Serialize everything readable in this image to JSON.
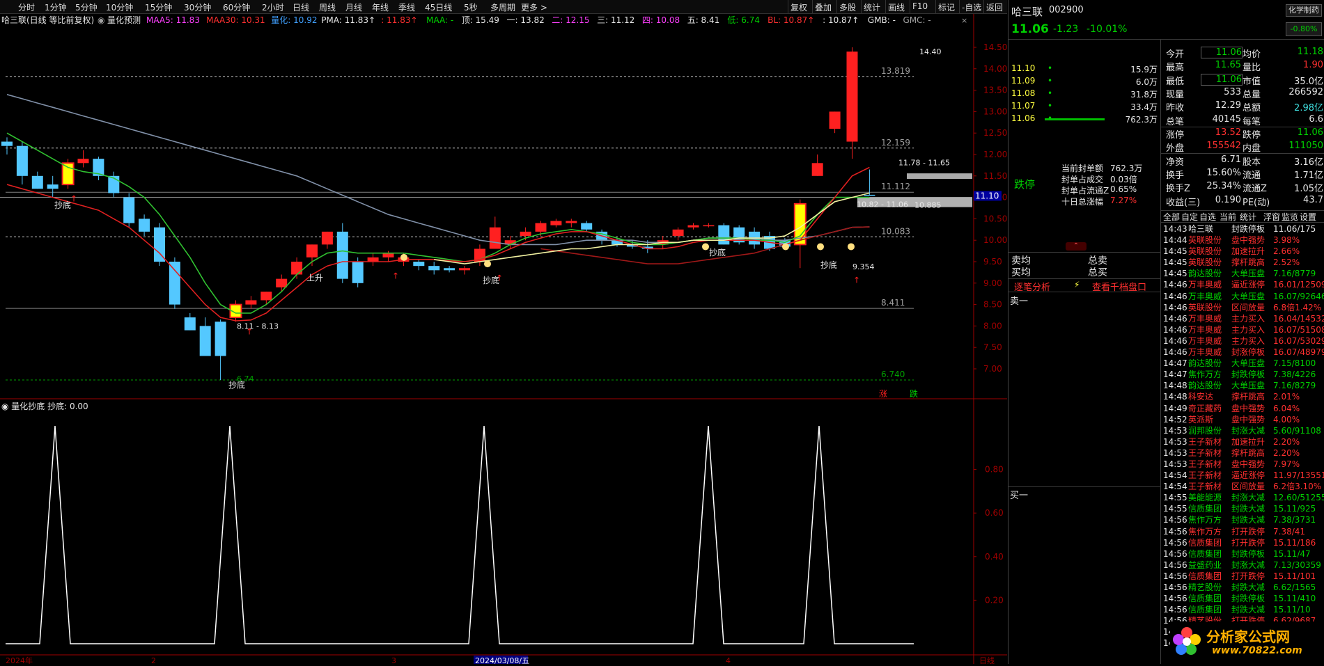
{
  "toolbar": {
    "periods": [
      "分时",
      "1分钟",
      "5分钟",
      "10分钟",
      "15分钟",
      "30分钟",
      "60分钟",
      "2小时",
      "日线",
      "周线",
      "月线",
      "年线",
      "季线",
      "45日线",
      "5秒",
      "多周期",
      "更多 >"
    ],
    "right_buttons": [
      "复权",
      "叠加",
      "多股",
      "统计",
      "画线",
      "F10",
      "标记",
      "-自选",
      "返回"
    ]
  },
  "main_chart": {
    "title": "哈三联(日线 等比前复权)",
    "indicator_name": "量化预测",
    "legend": [
      {
        "text": "MAA5: 11.83",
        "color": "#ff40ff"
      },
      {
        "text": "MAA30: 10.31",
        "color": "#ff3030"
      },
      {
        "text": "量化: 10.92",
        "color": "#40a0ff"
      },
      {
        "text": "PMA: 11.83↑",
        "color": "#e6e6e6"
      },
      {
        "text": ": 11.83↑",
        "color": "#ff3030"
      },
      {
        "text": "MAA: -",
        "color": "#00d000"
      },
      {
        "text": "顶: 15.49",
        "color": "#e6e6e6"
      },
      {
        "text": "一: 13.82",
        "color": "#e6e6e6"
      },
      {
        "text": "二: 12.15",
        "color": "#ff40ff"
      },
      {
        "text": "三: 11.12",
        "color": "#e6e6e6"
      },
      {
        "text": "四: 10.08",
        "color": "#ff40ff"
      },
      {
        "text": "五: 8.41",
        "color": "#e6e6e6"
      },
      {
        "text": "低: 6.74",
        "color": "#00d000"
      },
      {
        "text": "BL: 10.87↑",
        "color": "#ff3030"
      },
      {
        "text": ": 10.87↑",
        "color": "#e6e6e6"
      },
      {
        "text": "GMB: -",
        "color": "#e6e6e6"
      },
      {
        "text": "GMC: -",
        "color": "#a0a0a0"
      }
    ],
    "y_ticks": [
      "14.50",
      "14.00",
      "13.50",
      "13.00",
      "12.50",
      "12.00",
      "11.50",
      "11.00",
      "10.50",
      "10.00",
      "9.50",
      "9.00",
      "8.50",
      "8.00",
      "7.50",
      "7.00"
    ],
    "current_price_tag": "11.10",
    "level_labels": [
      "13.819",
      "12.159",
      "11.112",
      "10.083",
      "8.411",
      "6.740"
    ],
    "annotations": [
      "14.40",
      "11.78 - 11.65",
      "10.82 - 11.06",
      "10.885",
      "8.11 - 8.13",
      "6.74",
      "9.354"
    ],
    "signal_text": "抄底",
    "rise_text": "上升",
    "corner_labels": {
      "up": "涨",
      "down": "跌"
    }
  },
  "sub_chart": {
    "title": "量化抄底 抄底: 0.00",
    "y_ticks": [
      "0.80",
      "0.60",
      "0.40",
      "0.20"
    ]
  },
  "x_axis": {
    "labels": [
      "2024年",
      "2",
      "3",
      "2024/03/08/五",
      "4"
    ],
    "period": "日线"
  },
  "quote": {
    "name": "哈三联",
    "code": "002900",
    "tag": "化学制药",
    "price": "11.06",
    "change": "-1.23",
    "change_pct": "-10.01%",
    "sector_pct": "-0.80%",
    "order_book": [
      {
        "price": "11.10",
        "vol": "15.9万",
        "bar": 0
      },
      {
        "price": "11.09",
        "vol": "6.0万",
        "bar": 0
      },
      {
        "price": "11.08",
        "vol": "31.8万",
        "bar": 0
      },
      {
        "price": "11.07",
        "vol": "33.4万",
        "bar": 0
      },
      {
        "price": "11.06",
        "vol": "762.3万",
        "bar": 1
      }
    ],
    "stats": [
      {
        "l": "今开",
        "v": "11.06",
        "l2": "均价",
        "v2": "11.18"
      },
      {
        "l": "最高",
        "v": "11.65",
        "l2": "量比",
        "v2": "1.90"
      },
      {
        "l": "最低",
        "v": "11.06",
        "l2": "市值",
        "v2": "35.0亿"
      },
      {
        "l": "现量",
        "v": "533",
        "l2": "总量",
        "v2": "266592"
      },
      {
        "l": "昨收",
        "v": "12.29",
        "l2": "总额",
        "v2": "2.98亿"
      },
      {
        "l": "总笔",
        "v": "40145",
        "l2": "每笔",
        "v2": "6.6"
      },
      {
        "l": "涨停",
        "v": "13.52",
        "l2": "跌停",
        "v2": "11.06"
      },
      {
        "l": "外盘",
        "v": "155542",
        "l2": "内盘",
        "v2": "111050"
      },
      {
        "l": "净资",
        "v": "6.71",
        "l2": "股本",
        "v2": "3.16亿"
      },
      {
        "l": "换手",
        "v": "15.60%",
        "l2": "流通",
        "v2": "1.71亿"
      },
      {
        "l": "换手Z",
        "v": "25.34%",
        "l2": "流通Z",
        "v2": "1.05亿"
      },
      {
        "l": "收益(三)",
        "v": "0.190",
        "l2": "PE(动)",
        "v2": "43.7"
      }
    ],
    "limit": {
      "status": "跌停",
      "lines": [
        {
          "k": "当前封单额",
          "v": "762.3万"
        },
        {
          "k": "封单占成交",
          "v": "0.03倍"
        },
        {
          "k": "封单占流通Z",
          "v": "0.65%"
        },
        {
          "k": "十日总涨幅",
          "v": "7.27%"
        }
      ]
    },
    "sell_avg": "卖均",
    "buy_avg": "买均",
    "total_sell": "总卖",
    "total_buy": "总买",
    "tick_analysis": "逐笔分析",
    "thousand_levels": "查看千档盘口",
    "sell1": "卖一",
    "buy1": "买一"
  },
  "news_tabs": [
    "全部",
    "自定",
    "自选",
    "当前",
    "统计",
    "浮窗",
    "监览",
    "设置"
  ],
  "ticks": [
    {
      "t": "14:43",
      "n": "哈三联",
      "e": "封跌停板",
      "v": "11.06/175",
      "c": "w"
    },
    {
      "t": "14:44",
      "n": "英联股份",
      "e": "盘中强势",
      "v": "3.98%",
      "c": "r"
    },
    {
      "t": "14:45",
      "n": "英联股份",
      "e": "加速拉升",
      "v": "2.66%",
      "c": "r"
    },
    {
      "t": "14:45",
      "n": "英联股份",
      "e": "撑杆跳高",
      "v": "2.52%",
      "c": "r"
    },
    {
      "t": "14:45",
      "n": "韵达股份",
      "e": "大单压盘",
      "v": "7.16/8779",
      "c": "g"
    },
    {
      "t": "14:46",
      "n": "万丰奥威",
      "e": "逼近涨停",
      "v": "16.01/12509",
      "c": "r"
    },
    {
      "t": "14:46",
      "n": "万丰奥威",
      "e": "大单压盘",
      "v": "16.07/92646",
      "c": "g"
    },
    {
      "t": "14:46",
      "n": "英联股份",
      "e": "区间放量",
      "v": "6.8倍1.42%",
      "c": "r"
    },
    {
      "t": "14:46",
      "n": "万丰奥威",
      "e": "主力买入",
      "v": "16.04/14532",
      "c": "r"
    },
    {
      "t": "14:46",
      "n": "万丰奥威",
      "e": "主力买入",
      "v": "16.07/51508",
      "c": "r"
    },
    {
      "t": "14:46",
      "n": "万丰奥威",
      "e": "主力买入",
      "v": "16.07/53029",
      "c": "r"
    },
    {
      "t": "14:46",
      "n": "万丰奥威",
      "e": "封涨停板",
      "v": "16.07/489794",
      "c": "r"
    },
    {
      "t": "14:47",
      "n": "韵达股份",
      "e": "大单压盘",
      "v": "7.15/8100",
      "c": "g"
    },
    {
      "t": "14:47",
      "n": "焦作万方",
      "e": "封跌停板",
      "v": "7.38/4226",
      "c": "g"
    },
    {
      "t": "14:48",
      "n": "韵达股份",
      "e": "大单压盘",
      "v": "7.16/8279",
      "c": "g"
    },
    {
      "t": "14:48",
      "n": "科安达",
      "e": "撑杆跳高",
      "v": "2.01%",
      "c": "r"
    },
    {
      "t": "14:49",
      "n": "奇正藏药",
      "e": "盘中强势",
      "v": "6.04%",
      "c": "r"
    },
    {
      "t": "14:52",
      "n": "英派斯",
      "e": "盘中强势",
      "v": "4.00%",
      "c": "r"
    },
    {
      "t": "14:53",
      "n": "润邦股份",
      "e": "封涨大减",
      "v": "5.60/91108",
      "c": "g"
    },
    {
      "t": "14:53",
      "n": "王子新材",
      "e": "加速拉升",
      "v": "2.20%",
      "c": "r"
    },
    {
      "t": "14:53",
      "n": "王子新材",
      "e": "撑杆跳高",
      "v": "2.20%",
      "c": "r"
    },
    {
      "t": "14:53",
      "n": "王子新材",
      "e": "盘中强势",
      "v": "7.97%",
      "c": "r"
    },
    {
      "t": "14:54",
      "n": "王子新材",
      "e": "逼近涨停",
      "v": "11.97/13551",
      "c": "r"
    },
    {
      "t": "14:54",
      "n": "王子新材",
      "e": "区间放量",
      "v": "6.2倍3.10%",
      "c": "r"
    },
    {
      "t": "14:55",
      "n": "美能能源",
      "e": "封涨大减",
      "v": "12.60/51255",
      "c": "g"
    },
    {
      "t": "14:55",
      "n": "信质集团",
      "e": "封跌大减",
      "v": "15.11/925",
      "c": "g"
    },
    {
      "t": "14:56",
      "n": "焦作万方",
      "e": "封跌大减",
      "v": "7.38/3731",
      "c": "g"
    },
    {
      "t": "14:56",
      "n": "焦作万方",
      "e": "打开跌停",
      "v": "7.38/41",
      "c": "r"
    },
    {
      "t": "14:56",
      "n": "信质集团",
      "e": "打开跌停",
      "v": "15.11/186",
      "c": "r"
    },
    {
      "t": "14:56",
      "n": "信质集团",
      "e": "封跌停板",
      "v": "15.11/47",
      "c": "g"
    },
    {
      "t": "14:56",
      "n": "益盛药业",
      "e": "封涨大减",
      "v": "7.13/30359",
      "c": "g"
    },
    {
      "t": "14:56",
      "n": "信质集团",
      "e": "打开跌停",
      "v": "15.11/101",
      "c": "r"
    },
    {
      "t": "14:56",
      "n": "精艺股份",
      "e": "封跌大减",
      "v": "6.62/1565",
      "c": "g"
    },
    {
      "t": "14:56",
      "n": "信质集团",
      "e": "封跌停板",
      "v": "15.11/410",
      "c": "g"
    },
    {
      "t": "14:56",
      "n": "信质集团",
      "e": "封跌大减",
      "v": "15.11/10",
      "c": "g"
    },
    {
      "t": "14:56",
      "n": "精艺股份",
      "e": "打开跌停",
      "v": "6.62/9687",
      "c": "r"
    },
    {
      "t": "14:5",
      "n": "",
      "e": "",
      "v": "",
      "c": "w"
    },
    {
      "t": "14:5",
      "n": "",
      "e": "",
      "v": "",
      "c": "w"
    }
  ],
  "watermark": {
    "text": "分析家公式网",
    "url": "www.70822.com"
  },
  "chart_data": {
    "type": "candlestick",
    "ylim": [
      6.6,
      14.7
    ],
    "candles": [
      {
        "o": 12.2,
        "h": 12.4,
        "l": 12.0,
        "c": 12.3,
        "u": 0
      },
      {
        "o": 12.2,
        "h": 12.3,
        "l": 11.3,
        "c": 11.5,
        "u": 0
      },
      {
        "o": 11.5,
        "h": 11.6,
        "l": 11.2,
        "c": 11.2,
        "u": 0
      },
      {
        "o": 11.3,
        "h": 11.5,
        "l": 11.0,
        "c": 11.2,
        "u": 0
      },
      {
        "o": 11.3,
        "h": 11.9,
        "l": 11.2,
        "c": 11.8,
        "u": 1
      },
      {
        "o": 11.8,
        "h": 12.1,
        "l": 11.7,
        "c": 11.9,
        "u": 1
      },
      {
        "o": 11.9,
        "h": 11.95,
        "l": 11.4,
        "c": 11.5,
        "u": 0
      },
      {
        "o": 11.5,
        "h": 11.6,
        "l": 11.0,
        "c": 11.1,
        "u": 0
      },
      {
        "o": 11.0,
        "h": 11.1,
        "l": 10.3,
        "c": 10.4,
        "u": 0
      },
      {
        "o": 10.5,
        "h": 10.6,
        "l": 10.1,
        "c": 10.2,
        "u": 0
      },
      {
        "o": 10.3,
        "h": 10.4,
        "l": 9.4,
        "c": 9.5,
        "u": 0
      },
      {
        "o": 9.5,
        "h": 9.6,
        "l": 8.4,
        "c": 8.5,
        "u": 0
      },
      {
        "o": 8.2,
        "h": 8.3,
        "l": 7.9,
        "c": 7.9,
        "u": 0
      },
      {
        "o": 8.0,
        "h": 8.2,
        "l": 7.3,
        "c": 7.3,
        "u": 0
      },
      {
        "o": 8.1,
        "h": 8.15,
        "l": 6.74,
        "c": 7.3,
        "u": 0
      },
      {
        "o": 8.2,
        "h": 8.6,
        "l": 8.1,
        "c": 8.5,
        "u": 1
      },
      {
        "o": 8.5,
        "h": 8.7,
        "l": 8.4,
        "c": 8.6,
        "u": 1
      },
      {
        "o": 8.6,
        "h": 8.8,
        "l": 8.5,
        "c": 8.8,
        "u": 1
      },
      {
        "o": 8.9,
        "h": 9.2,
        "l": 8.8,
        "c": 9.1,
        "u": 1
      },
      {
        "o": 9.2,
        "h": 9.6,
        "l": 9.1,
        "c": 9.5,
        "u": 1
      },
      {
        "o": 9.6,
        "h": 9.9,
        "l": 9.4,
        "c": 9.9,
        "u": 1
      },
      {
        "o": 9.9,
        "h": 10.2,
        "l": 9.8,
        "c": 10.2,
        "u": 1
      },
      {
        "o": 10.2,
        "h": 10.4,
        "l": 9.0,
        "c": 9.1,
        "u": 0
      },
      {
        "o": 9.5,
        "h": 9.6,
        "l": 8.9,
        "c": 9.0,
        "u": 0
      },
      {
        "o": 9.5,
        "h": 9.7,
        "l": 9.4,
        "c": 9.6,
        "u": 1
      },
      {
        "o": 9.6,
        "h": 9.75,
        "l": 9.5,
        "c": 9.7,
        "u": 1
      },
      {
        "o": 9.6,
        "h": 9.7,
        "l": 9.4,
        "c": 9.5,
        "u": 1
      },
      {
        "o": 9.5,
        "h": 9.55,
        "l": 9.3,
        "c": 9.4,
        "u": 0
      },
      {
        "o": 9.4,
        "h": 9.5,
        "l": 9.2,
        "c": 9.3,
        "u": 0
      },
      {
        "o": 9.35,
        "h": 9.4,
        "l": 9.25,
        "c": 9.3,
        "u": 0
      },
      {
        "o": 9.3,
        "h": 9.4,
        "l": 9.2,
        "c": 9.35,
        "u": 1
      },
      {
        "o": 9.5,
        "h": 9.9,
        "l": 9.4,
        "c": 9.8,
        "u": 1
      },
      {
        "o": 9.8,
        "h": 10.55,
        "l": 9.8,
        "c": 10.3,
        "u": 1
      },
      {
        "o": 9.9,
        "h": 10.1,
        "l": 9.8,
        "c": 10.0,
        "u": 1
      },
      {
        "o": 10.1,
        "h": 10.3,
        "l": 10.0,
        "c": 10.2,
        "u": 1
      },
      {
        "o": 10.2,
        "h": 10.45,
        "l": 10.1,
        "c": 10.4,
        "u": 1
      },
      {
        "o": 10.35,
        "h": 10.5,
        "l": 10.3,
        "c": 10.45,
        "u": 1
      },
      {
        "o": 10.4,
        "h": 10.5,
        "l": 10.3,
        "c": 10.45,
        "u": 1
      },
      {
        "o": 10.4,
        "h": 10.45,
        "l": 10.2,
        "c": 10.25,
        "u": 0
      },
      {
        "o": 10.2,
        "h": 10.25,
        "l": 9.9,
        "c": 10.0,
        "u": 0
      },
      {
        "o": 10.0,
        "h": 10.05,
        "l": 9.85,
        "c": 9.9,
        "u": 0
      },
      {
        "o": 9.9,
        "h": 10.0,
        "l": 9.8,
        "c": 9.85,
        "u": 0
      },
      {
        "o": 9.85,
        "h": 10.0,
        "l": 9.7,
        "c": 9.8,
        "u": 0
      },
      {
        "o": 9.9,
        "h": 10.1,
        "l": 9.8,
        "c": 10.0,
        "u": 1
      },
      {
        "o": 10.1,
        "h": 10.3,
        "l": 10.0,
        "c": 10.25,
        "u": 1
      },
      {
        "o": 10.3,
        "h": 10.4,
        "l": 10.25,
        "c": 10.35,
        "u": 1
      },
      {
        "o": 10.35,
        "h": 10.4,
        "l": 10.3,
        "c": 10.35,
        "u": 1
      },
      {
        "o": 10.35,
        "h": 10.4,
        "l": 9.9,
        "c": 9.9,
        "u": 0
      },
      {
        "o": 10.3,
        "h": 10.35,
        "l": 9.9,
        "c": 9.95,
        "u": 0
      },
      {
        "o": 10.2,
        "h": 10.3,
        "l": 9.8,
        "c": 9.9,
        "u": 0
      },
      {
        "o": 10.1,
        "h": 10.2,
        "l": 9.75,
        "c": 9.8,
        "u": 0
      },
      {
        "o": 10.0,
        "h": 10.05,
        "l": 9.8,
        "c": 9.85,
        "u": 0
      },
      {
        "o": 9.9,
        "h": 10.95,
        "l": 9.35,
        "c": 10.85,
        "u": 1
      },
      {
        "o": 11.8,
        "h": 12.0,
        "l": 11.5,
        "c": 11.5,
        "u": 1
      },
      {
        "o": 12.6,
        "h": 13.0,
        "l": 12.5,
        "c": 13.0,
        "u": 1
      },
      {
        "o": 14.4,
        "h": 14.5,
        "l": 11.9,
        "c": 12.3,
        "u": 1
      },
      {
        "o": 11.06,
        "h": 11.65,
        "l": 11.06,
        "c": 11.06,
        "u": 0
      }
    ],
    "ma_red": [
      11.3,
      11.2,
      11.1,
      11.0,
      10.9,
      10.8,
      10.7,
      10.5,
      10.3,
      10.0,
      9.7,
      9.3,
      8.9,
      8.5,
      8.2,
      8.12,
      8.14,
      8.3,
      8.6,
      8.9,
      9.2,
      9.4,
      9.5,
      9.5,
      9.5,
      9.5,
      9.55,
      9.55,
      9.55,
      9.52,
      9.5,
      9.55,
      9.65,
      9.8,
      9.95,
      10.05,
      10.15,
      10.2,
      10.2,
      10.1,
      10.0,
      9.9,
      9.8,
      9.8,
      9.85,
      9.95,
      10.0,
      10.0,
      10.0,
      10.0,
      9.95,
      9.9,
      10.0,
      10.5,
      11.0,
      11.5,
      11.7
    ],
    "ma_green": [
      12.5,
      12.3,
      12.1,
      11.9,
      11.7,
      11.6,
      11.55,
      11.45,
      11.25,
      11.0,
      10.6,
      10.1,
      9.6,
      9.0,
      8.5,
      8.3,
      8.3,
      8.5,
      8.8,
      9.2,
      9.5,
      9.7,
      9.75,
      9.7,
      9.7,
      9.7,
      9.7,
      9.65,
      9.6,
      9.55,
      9.5,
      9.55,
      9.7,
      9.9,
      10.05,
      10.15,
      10.2,
      10.25,
      10.2,
      10.15,
      10.05,
      9.95,
      9.9,
      9.9,
      9.95,
      10.0,
      10.05,
      10.05,
      10.05,
      10.0,
      10.0,
      9.95,
      10.1,
      10.6,
      11.0,
      11.0,
      11.0
    ],
    "ma_gray": [
      13.4,
      13.3,
      13.2,
      13.1,
      13.0,
      12.9,
      12.8,
      12.7,
      12.6,
      12.5,
      12.4,
      12.3,
      12.2,
      12.1,
      12.0,
      11.9,
      11.8,
      11.7,
      11.6,
      11.5,
      11.35,
      11.2,
      11.05,
      10.9,
      10.75,
      10.6,
      10.5,
      10.4,
      10.3,
      10.2,
      10.1,
      10.0,
      9.95,
      9.9,
      9.9,
      9.9,
      9.9,
      9.95,
      10.0,
      10.0,
      10.0,
      10.0,
      9.95,
      9.95,
      9.95,
      10.0,
      10.05,
      10.05,
      10.05,
      10.05,
      10.0,
      10.0,
      10.05,
      10.1,
      10.2,
      10.3,
      10.31
    ],
    "ma_darkred": [
      9.8,
      9.75,
      9.7,
      9.65,
      9.6,
      9.55,
      9.5,
      9.45,
      9.45,
      9.45,
      9.5,
      9.55,
      9.6,
      9.65,
      9.7,
      9.8,
      9.9,
      10.0,
      10.1,
      10.2,
      10.3,
      10.31
    ],
    "ma_white": [
      9.55,
      9.5,
      9.45,
      9.5,
      9.55,
      9.6,
      9.65,
      9.7,
      9.75,
      9.8,
      9.8,
      9.85,
      9.9,
      9.9,
      9.9,
      9.95,
      9.95,
      10.0,
      10.0,
      10.0,
      10.05,
      10.05,
      10.05,
      10.1,
      10.3,
      10.6,
      10.9,
      11.0,
      11.1
    ],
    "levels": [
      13.82,
      12.15,
      11.12,
      10.08,
      8.41,
      6.74
    ],
    "buy_signals_idx": [
      3,
      14,
      31,
      44,
      48,
      52
    ],
    "sub_peaks_idx": [
      3,
      14,
      31,
      45,
      52
    ]
  }
}
